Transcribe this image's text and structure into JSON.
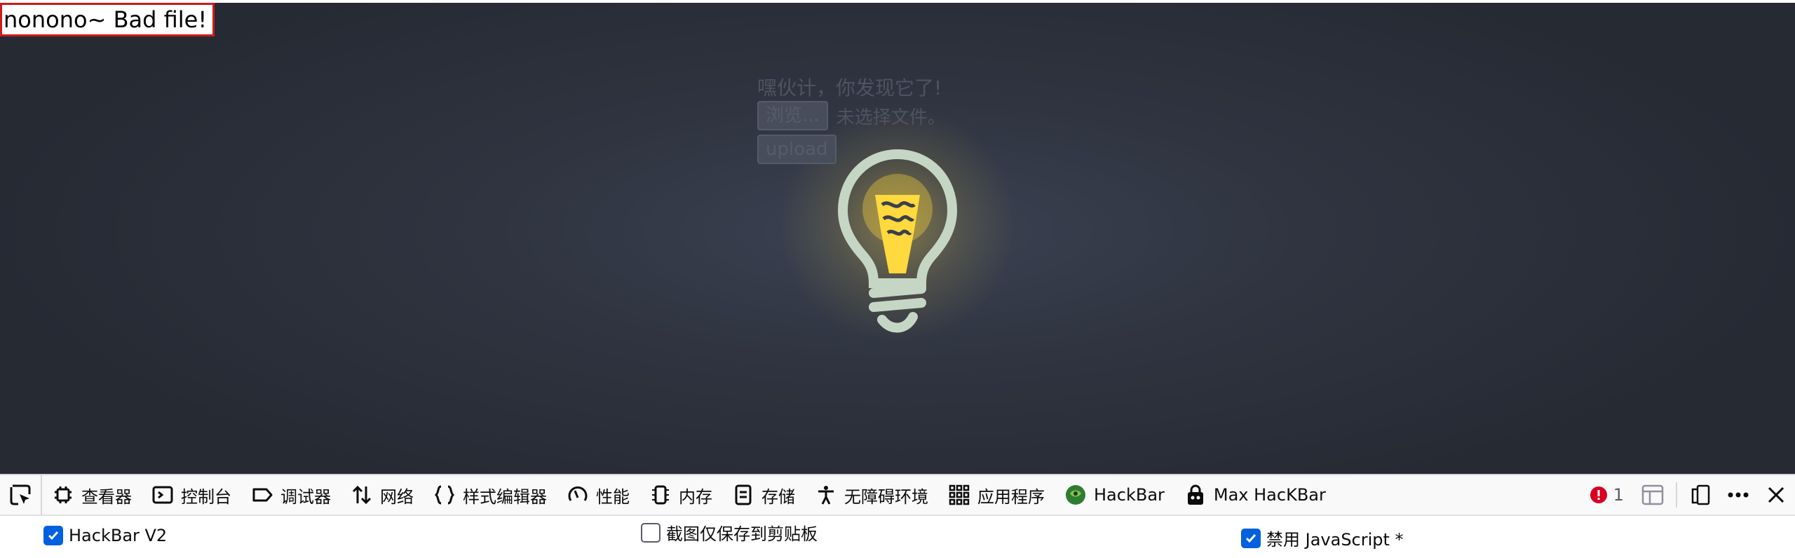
{
  "page": {
    "message": "nonono~ Bad file!",
    "hint": "嘿伙计，你发现它了!",
    "browse_label": "浏览...",
    "no_file_text": "未选择文件。",
    "upload_label": "upload"
  },
  "devtools": {
    "tabs": [
      {
        "label": "查看器",
        "icon": "inspector-icon"
      },
      {
        "label": "控制台",
        "icon": "console-icon"
      },
      {
        "label": "调试器",
        "icon": "debugger-icon"
      },
      {
        "label": "网络",
        "icon": "network-icon"
      },
      {
        "label": "样式编辑器",
        "icon": "style-editor-icon"
      },
      {
        "label": "性能",
        "icon": "performance-icon"
      },
      {
        "label": "内存",
        "icon": "memory-icon"
      },
      {
        "label": "存储",
        "icon": "storage-icon"
      },
      {
        "label": "无障碍环境",
        "icon": "accessibility-icon"
      },
      {
        "label": "应用程序",
        "icon": "application-icon"
      },
      {
        "label": "HackBar",
        "icon": "hackbar-icon"
      },
      {
        "label": "Max HacKBar",
        "icon": "max-hackbar-icon"
      }
    ],
    "error_count": "1"
  },
  "settings": {
    "hackbar_v2": {
      "label": "HackBar V2",
      "checked": true
    },
    "screenshot_clipboard": {
      "label": "截图仅保存到剪贴板",
      "checked": false
    },
    "disable_js": {
      "label": "禁用 JavaScript *",
      "checked": true
    }
  },
  "colors": {
    "accent": "#0060df",
    "error_red": "#d70022",
    "bulb_yellow": "#ffd93d",
    "bulb_outline": "#c5d6c4"
  }
}
